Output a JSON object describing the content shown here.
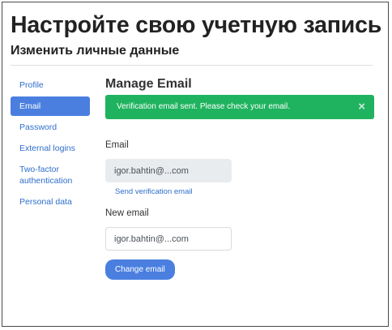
{
  "page": {
    "title": "Настройте свою учетную запись",
    "subtitle": "Изменить личные данные"
  },
  "nav": {
    "items": [
      {
        "label": "Profile",
        "active": false
      },
      {
        "label": "Email",
        "active": true
      },
      {
        "label": "Password",
        "active": false
      },
      {
        "label": "External logins",
        "active": false
      },
      {
        "label": "Two-factor authentication",
        "active": false
      },
      {
        "label": "Personal data",
        "active": false
      }
    ]
  },
  "manage_email": {
    "title": "Manage Email",
    "alert": {
      "message": "Verification email sent. Please check your email.",
      "close_symbol": "×"
    },
    "email": {
      "label": "Email",
      "value": "igor.bahtin@...com",
      "send_verification_label": "Send verification email"
    },
    "new_email": {
      "label": "New email",
      "value": "igor.bahtin@...com"
    },
    "change_button_label": "Change email"
  },
  "colors": {
    "accent": "#4a7fe0",
    "link": "#2f6ecb",
    "success": "#1fb35f"
  }
}
